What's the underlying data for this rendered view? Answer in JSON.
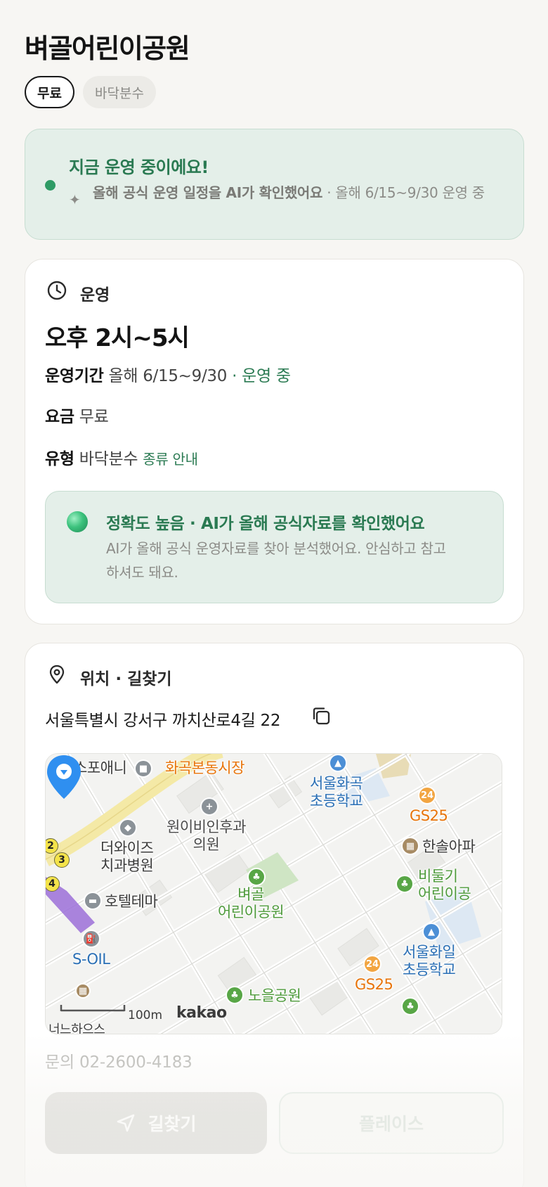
{
  "place": {
    "title": "벼골어린이공원"
  },
  "chips": [
    {
      "label": "무료"
    },
    {
      "label": "바닥분수"
    }
  ],
  "status": {
    "title": "지금 운영 중이에요!",
    "ai_check_bold": "올해 공식 운영 일정을 AI가 확인했어요",
    "ai_check_detail": " · 올해 6/15~9/30 운영 중"
  },
  "operation": {
    "section_label": "운영",
    "hours": "오후 2시~5시",
    "period_label": "운영기간",
    "period_value": "올해 6/15~9/30",
    "period_sep": " · ",
    "period_status": "운영 중",
    "fee_label": "요금",
    "fee_value": "무료",
    "type_label": "유형",
    "type_value": "바닥분수",
    "type_link": "종류 안내",
    "accuracy": {
      "title": "정확도 높음 · AI가 올해 공식자료를 확인했어요",
      "desc": "AI가 올해 공식 운영자료를 찾아 분석했어요. 안심하고 참고하셔도 돼요."
    }
  },
  "location": {
    "section_label": "위치 · 길찾기",
    "address": "서울특별시 강서구 까치산로4길 22",
    "map": {
      "labels": {
        "spoany": "스포애니",
        "market": "화곡본동시장",
        "hwagok_school": "서울화곡\n초등학교",
        "gs25_a": "GS25",
        "wonibi": "원이비인후과\n의원",
        "hansol": "한솔아파",
        "dawise": "더와이즈\n치과병원",
        "bidulgi": "비둘기\n어린이공",
        "hotel": "호텔테마",
        "park": "벼골\n어린이공원",
        "soil": "S-OIL",
        "hwail_school": "서울화일\n초등학교",
        "gs25_b": "GS25",
        "noeul": "노을공원",
        "bottom_partial": "너느하으스"
      },
      "scale": "100m",
      "brand": "kakao",
      "route_numbers": [
        "2",
        "3",
        "4"
      ]
    },
    "contact": "문의 02-2600-4183",
    "route_button": "길찾기",
    "place_button": "플레이스"
  },
  "colors": {
    "accent_green": "#2a7a52",
    "status_bg": "#e4efe9",
    "pin_blue": "#2f8ff0"
  }
}
